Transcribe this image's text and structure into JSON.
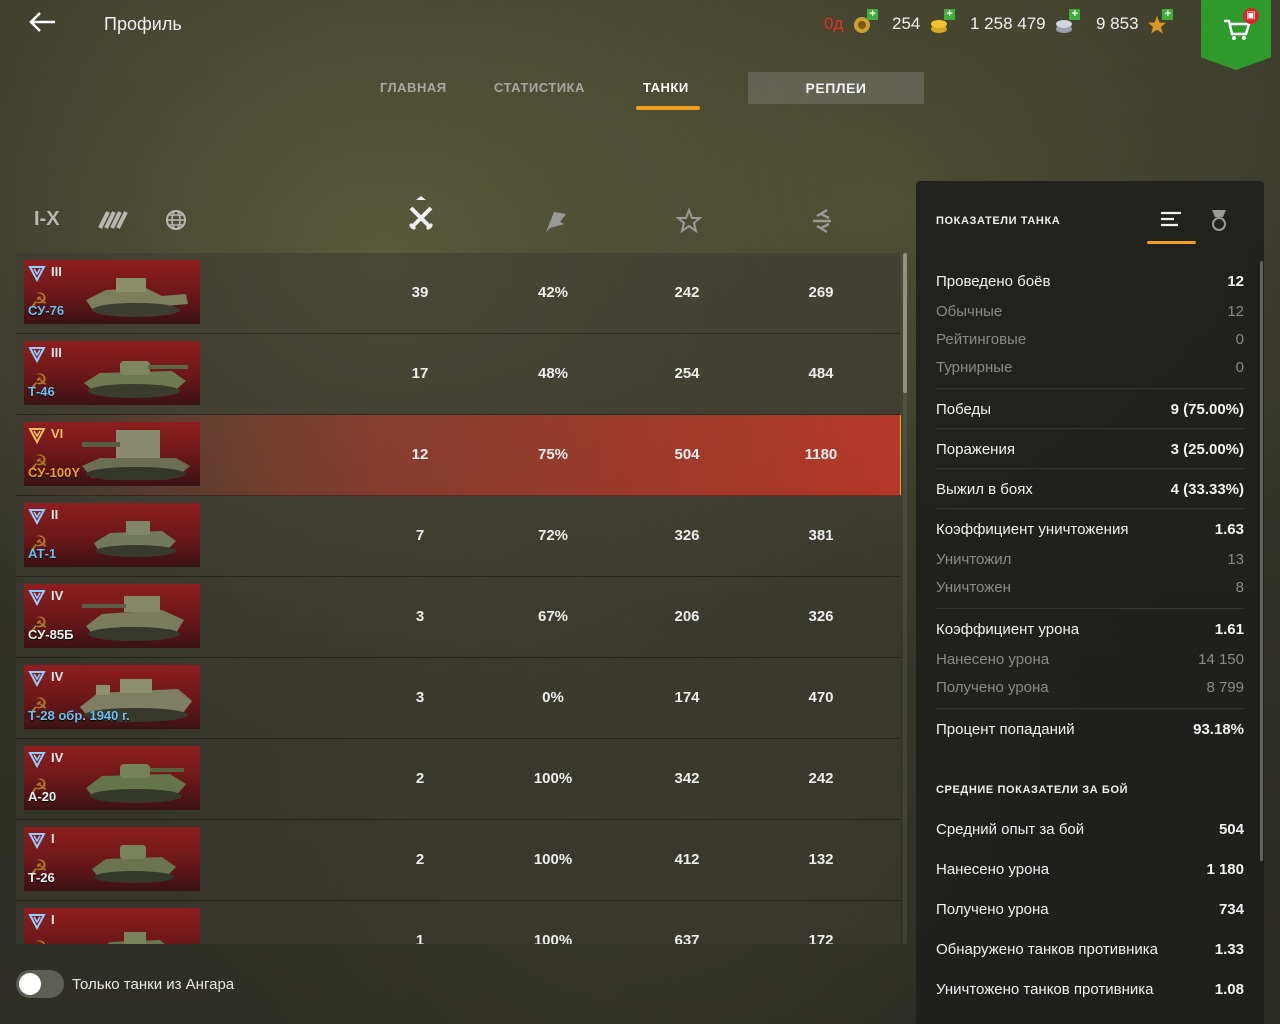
{
  "header": {
    "title": "Профиль",
    "currencies": [
      {
        "value": "0д",
        "icon": "premium-icon",
        "color": "#e0302a"
      },
      {
        "value": "254",
        "icon": "gold-icon",
        "color": "#f0f0f0"
      },
      {
        "value": "1 258 479",
        "icon": "credits-icon",
        "color": "#f0f0f0"
      },
      {
        "value": "9 853",
        "icon": "free-xp-icon",
        "color": "#f0f0f0"
      }
    ]
  },
  "tabs": [
    {
      "label": "ГЛАВНАЯ",
      "active": false
    },
    {
      "label": "СТАТИСТИКА",
      "active": false
    },
    {
      "label": "ТАНКИ",
      "active": true
    }
  ],
  "replays_button": "РЕПЛЕИ",
  "filters": {
    "tier_label": "I-X",
    "nation_icon": "nations-icon",
    "class_icon": "globe-icon"
  },
  "columns": [
    {
      "icon": "battles-icon"
    },
    {
      "icon": "wins-icon"
    },
    {
      "icon": "avg-xp-icon"
    },
    {
      "icon": "avg-damage-icon"
    }
  ],
  "tanks": [
    {
      "name": "СУ-76",
      "tier": "III",
      "name_color": "#6ec0f0",
      "battles": "39",
      "winrate": "42%",
      "xp": "242",
      "damage": "269",
      "selected": false
    },
    {
      "name": "Т-46",
      "tier": "III",
      "name_color": "#6ec0f0",
      "battles": "17",
      "winrate": "48%",
      "xp": "254",
      "damage": "484",
      "selected": false
    },
    {
      "name": "СУ-100Y",
      "tier": "VI",
      "name_color": "#f0a020",
      "battles": "12",
      "winrate": "75%",
      "xp": "504",
      "damage": "1180",
      "selected": true
    },
    {
      "name": "АТ-1",
      "tier": "II",
      "name_color": "#6ec0f0",
      "battles": "7",
      "winrate": "72%",
      "xp": "326",
      "damage": "381",
      "selected": false
    },
    {
      "name": "СУ-85Б",
      "tier": "IV",
      "name_color": "#f0f0f0",
      "battles": "3",
      "winrate": "67%",
      "xp": "206",
      "damage": "326",
      "selected": false
    },
    {
      "name": "Т-28 обр. 1940 г.",
      "tier": "IV",
      "name_color": "#6ec0f0",
      "battles": "3",
      "winrate": "0%",
      "xp": "174",
      "damage": "470",
      "selected": false
    },
    {
      "name": "А-20",
      "tier": "IV",
      "name_color": "#f0f0f0",
      "battles": "2",
      "winrate": "100%",
      "xp": "342",
      "damage": "242",
      "selected": false
    },
    {
      "name": "Т-26",
      "tier": "I",
      "name_color": "#f0f0f0",
      "battles": "2",
      "winrate": "100%",
      "xp": "412",
      "damage": "132",
      "selected": false
    },
    {
      "name": "",
      "tier": "I",
      "name_color": "#f0f0f0",
      "battles": "1",
      "winrate": "100%",
      "xp": "637",
      "damage": "172",
      "selected": false
    }
  ],
  "toggle": {
    "label": "Только танки из Ангара",
    "on": false
  },
  "panel": {
    "title": "ПОКАЗАТЕЛИ ТАНКА",
    "stats": [
      {
        "label": "Проведено боёв",
        "value": "12",
        "kind": "main"
      },
      {
        "label": "Обычные",
        "value": "12",
        "kind": "sub"
      },
      {
        "label": "Рейтинговые",
        "value": "0",
        "kind": "sub"
      },
      {
        "label": "Турнирные",
        "value": "0",
        "kind": "sub"
      },
      {
        "label": "Победы",
        "value": "9 (75.00%)",
        "kind": "main"
      },
      {
        "label": "Поражения",
        "value": "3 (25.00%)",
        "kind": "main"
      },
      {
        "label": "Выжил в боях",
        "value": "4 (33.33%)",
        "kind": "main"
      },
      {
        "label": "Коэффициент уничтожения",
        "value": "1.63",
        "kind": "main"
      },
      {
        "label": "Уничтожил",
        "value": "13",
        "kind": "sub"
      },
      {
        "label": "Уничтожен",
        "value": "8",
        "kind": "sub"
      },
      {
        "label": "Коэффициент урона",
        "value": "1.61",
        "kind": "main"
      },
      {
        "label": "Нанесено урона",
        "value": "14 150",
        "kind": "sub"
      },
      {
        "label": "Получено урона",
        "value": "8 799",
        "kind": "sub"
      },
      {
        "label": "Процент попаданий",
        "value": "93.18%",
        "kind": "main"
      }
    ],
    "section2_title": "СРЕДНИЕ ПОКАЗАТЕЛИ ЗА БОЙ",
    "avg_stats": [
      {
        "label": "Средний опыт за бой",
        "value": "504"
      },
      {
        "label": "Нанесено урона",
        "value": "1 180"
      },
      {
        "label": "Получено урона",
        "value": "734"
      },
      {
        "label": "Обнаружено танков противника",
        "value": "1.33"
      },
      {
        "label": "Уничтожено танков противника",
        "value": "1.08"
      }
    ]
  }
}
